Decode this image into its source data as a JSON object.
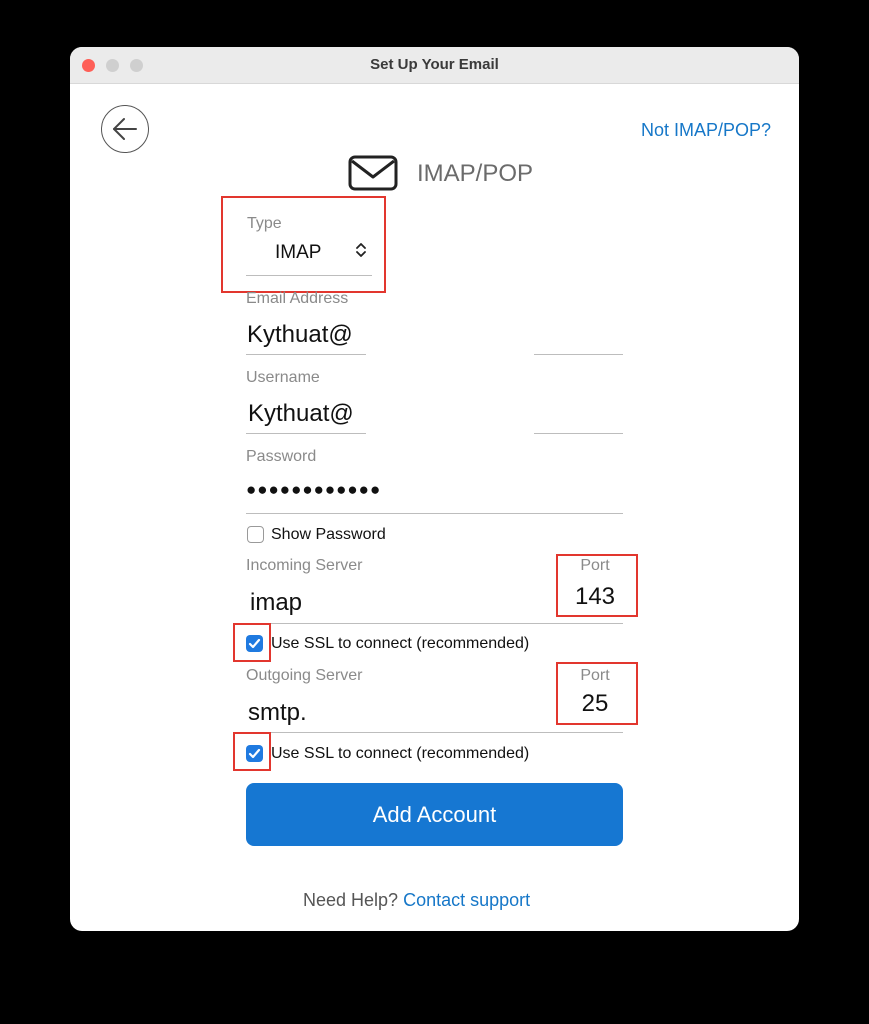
{
  "window": {
    "title": "Set Up Your Email"
  },
  "header": {
    "not_imap_link": "Not IMAP/POP?",
    "account_type_label": "IMAP/POP"
  },
  "form": {
    "type": {
      "label": "Type",
      "value": "IMAP",
      "chevron": "⌃⌄"
    },
    "email": {
      "label": "Email Address",
      "value": "Kythuat@"
    },
    "username": {
      "label": "Username",
      "value": "Kythuat@"
    },
    "password": {
      "label": "Password",
      "value": "●●●●●●●●●●●●"
    },
    "show_password": {
      "label": "Show Password",
      "checked": false
    },
    "incoming": {
      "label": "Incoming Server",
      "value": "imap",
      "port_label": "Port",
      "port": "143",
      "ssl_label": "Use SSL to connect (recommended)",
      "ssl_checked": true
    },
    "outgoing": {
      "label": "Outgoing Server",
      "value": "smtp.",
      "port_label": "Port",
      "port": "25",
      "ssl_label": "Use SSL to connect (recommended)",
      "ssl_checked": true
    }
  },
  "actions": {
    "add_account": "Add Account"
  },
  "footer": {
    "help_text": "Need Help?",
    "help_link": "Contact support"
  },
  "colors": {
    "accent": "#1677d2",
    "highlight_box": "#e2362e",
    "close_button": "#fe5f57"
  },
  "icons": [
    "back-arrow-icon",
    "mail-icon",
    "chevron-updown-icon",
    "checkmark-icon"
  ]
}
